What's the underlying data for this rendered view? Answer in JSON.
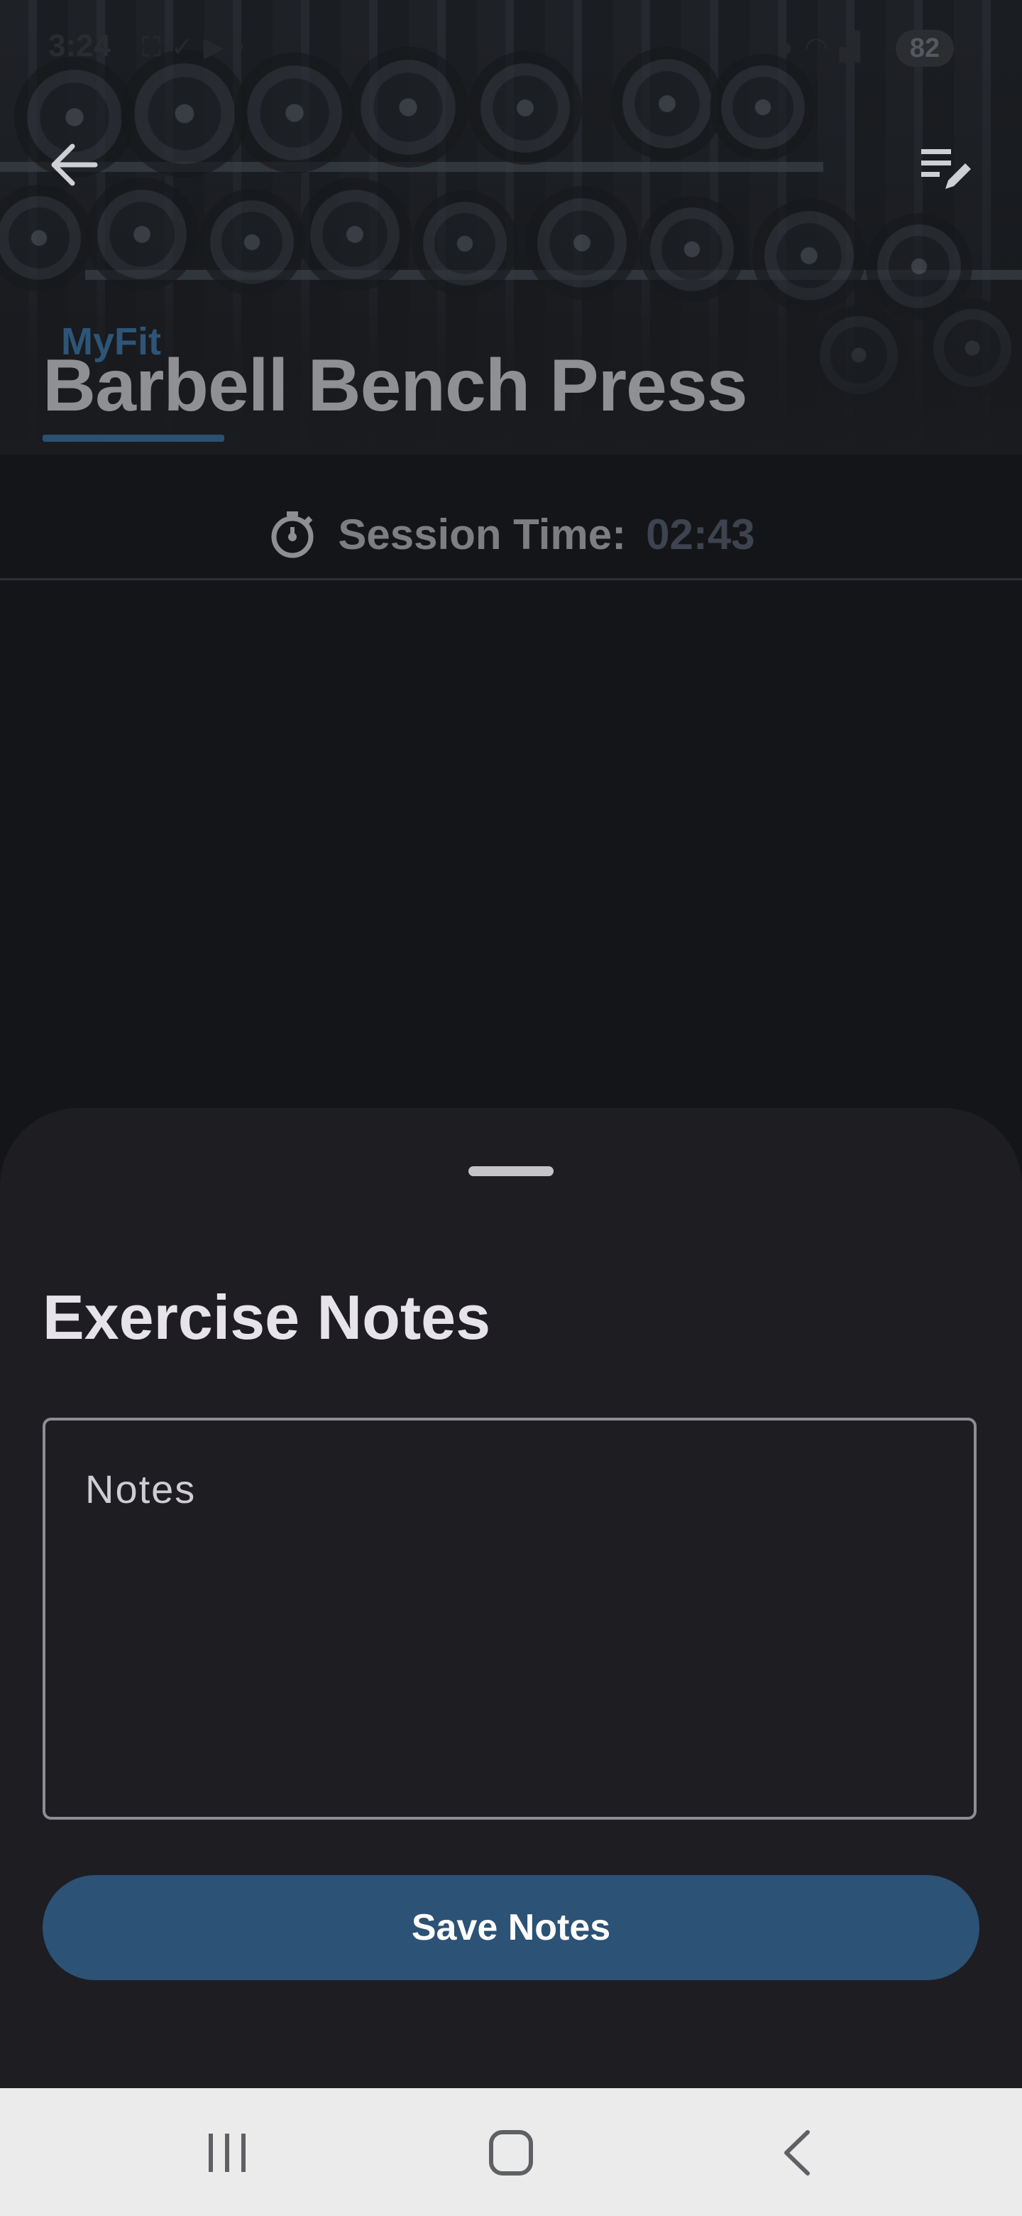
{
  "status_bar": {
    "time": "3:24",
    "left_icons": [
      "screenshot-icon",
      "check-circle-icon",
      "video-icon",
      "dot-icon"
    ],
    "right_icons": [
      "location-icon",
      "wifi-icon",
      "signal-icon"
    ],
    "battery": "82"
  },
  "header": {
    "back_icon": "arrow-left-icon",
    "edit_icon": "edit-list-icon",
    "brand": "MyFit",
    "title": "Barbell Bench Press"
  },
  "session": {
    "icon": "stopwatch-icon",
    "label": "Session Time:",
    "value": "02:43"
  },
  "sheet": {
    "title": "Exercise Notes",
    "notes_placeholder": "Notes",
    "notes_value": "",
    "save_label": "Save Notes"
  },
  "nav_bar": {
    "items": [
      "recent-apps-icon",
      "home-icon",
      "back-icon"
    ]
  },
  "colors": {
    "accent": "#2c5275",
    "sheet_bg": "#1e1d22",
    "page_bg": "#141518"
  }
}
